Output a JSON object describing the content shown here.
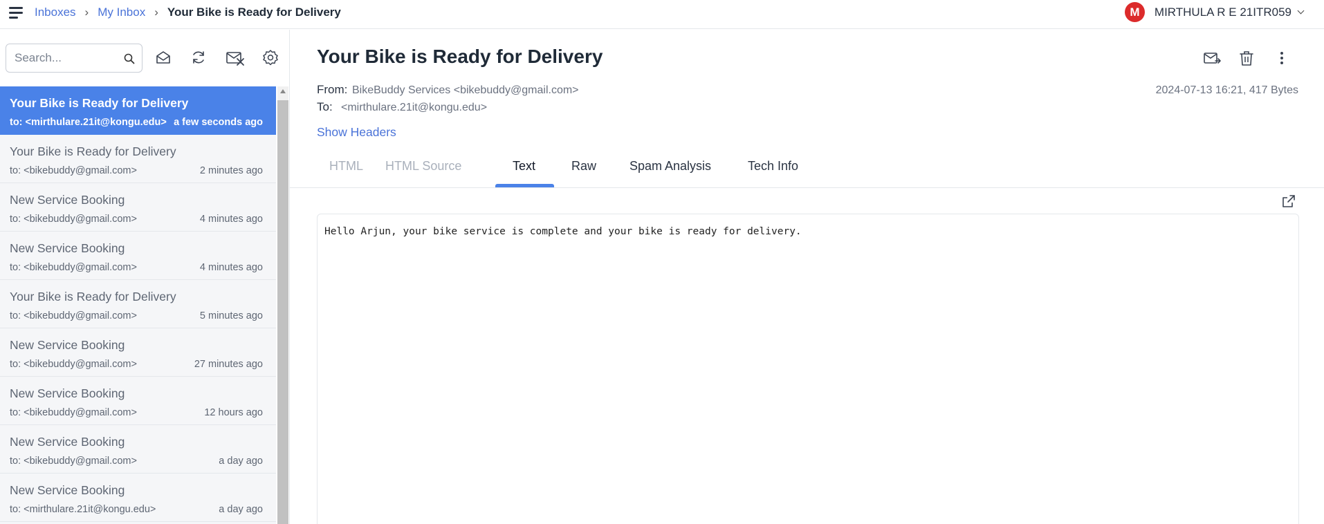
{
  "breadcrumb": {
    "root": "Inboxes",
    "inbox": "My Inbox",
    "current": "Your Bike is Ready for Delivery"
  },
  "user": {
    "initial": "M",
    "name": "MIRTHULA R E 21ITR059",
    "avatar_color": "#dc2b2b"
  },
  "search": {
    "placeholder": "Search..."
  },
  "toolbar_icons": [
    "mark-read-icon",
    "refresh-icon",
    "delete-all-icon",
    "settings-icon"
  ],
  "messages": [
    {
      "subject": "Your Bike is Ready for Delivery",
      "to": "to: <mirthulare.21it@kongu.edu>",
      "time": "a few seconds ago",
      "active": true
    },
    {
      "subject": "Your Bike is Ready for Delivery",
      "to": "to: <bikebuddy@gmail.com>",
      "time": "2 minutes ago"
    },
    {
      "subject": "New Service Booking",
      "to": "to: <bikebuddy@gmail.com>",
      "time": "4 minutes ago"
    },
    {
      "subject": "New Service Booking",
      "to": "to: <bikebuddy@gmail.com>",
      "time": "4 minutes ago"
    },
    {
      "subject": "Your Bike is Ready for Delivery",
      "to": "to: <bikebuddy@gmail.com>",
      "time": "5 minutes ago"
    },
    {
      "subject": "New Service Booking",
      "to": "to: <bikebuddy@gmail.com>",
      "time": "27 minutes ago"
    },
    {
      "subject": "New Service Booking",
      "to": "to: <bikebuddy@gmail.com>",
      "time": "12 hours ago"
    },
    {
      "subject": "New Service Booking",
      "to": "to: <bikebuddy@gmail.com>",
      "time": "a day ago"
    },
    {
      "subject": "New Service Booking",
      "to": "to: <mirthulare.21it@kongu.edu>",
      "time": "a day ago"
    }
  ],
  "message": {
    "title": "Your Bike is Ready for Delivery",
    "from_label": "From:",
    "from": "BikeBuddy Services <bikebuddy@gmail.com>",
    "to_label": "To:",
    "to": "<mirthulare.21it@kongu.edu>",
    "date_size": "2024-07-13 16:21, 417 Bytes",
    "show_headers": "Show Headers",
    "body": "Hello Arjun, your bike service is complete and your bike is ready for delivery."
  },
  "tabs": [
    {
      "label": "HTML",
      "state": "disabled"
    },
    {
      "label": "HTML Source",
      "state": "disabled"
    },
    {
      "label": "Text",
      "state": "active"
    },
    {
      "label": "Raw",
      "state": "normal"
    },
    {
      "label": "Spam Analysis",
      "state": "normal"
    },
    {
      "label": "Tech Info",
      "state": "normal"
    }
  ],
  "accent": "#4a82e8",
  "link_color": "#4a73d8"
}
